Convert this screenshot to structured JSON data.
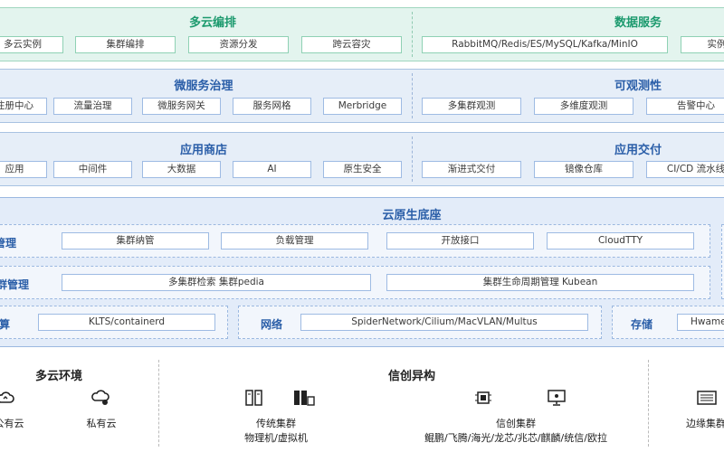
{
  "row1": {
    "left": {
      "title": "多云编排",
      "items": [
        "多云实例",
        "集群编排",
        "资源分发",
        "跨云容灾"
      ]
    },
    "right": {
      "title": "数据服务",
      "items": [
        "RabbitMQ/Redis/ES/MySQL/Kafka/MinIO",
        "实例"
      ]
    }
  },
  "row2": {
    "left": {
      "title": "微服务治理",
      "items": [
        "注册中心",
        "流量治理",
        "微服务网关",
        "服务网格",
        "Merbridge"
      ]
    },
    "right": {
      "title": "可观测性",
      "items": [
        "多集群观测",
        "多维度观测",
        "告警中心"
      ]
    }
  },
  "row3": {
    "left": {
      "title": "应用商店",
      "items": [
        "应用",
        "中间件",
        "大数据",
        "AI",
        "原生安全"
      ]
    },
    "right": {
      "title": "应用交付",
      "items": [
        "渐进式交付",
        "镜像仓库",
        "CI/CD 流水线"
      ]
    }
  },
  "core": {
    "title": "云原生底座",
    "container_mgmt": {
      "label": "容器管理",
      "items": [
        "集群纳管",
        "负载管理",
        "开放接口",
        "CloudTTY"
      ]
    },
    "cluster_mgmt": {
      "label": "多集群管理",
      "items": [
        "多集群检索 集群pedia",
        "集群生命周期管理 Kubean"
      ]
    },
    "compute": {
      "label": "计算",
      "items": [
        "KLTS/containerd"
      ]
    },
    "network": {
      "label": "网络",
      "items": [
        "SpiderNetwork/Cilium/MacVLAN/Multus"
      ]
    },
    "storage": {
      "label": "存储",
      "items": [
        "HwameiStor"
      ]
    }
  },
  "bottom": {
    "multicloud": {
      "title": "多云环境",
      "items": [
        {
          "label": "公有云",
          "icon": "cloud-icon"
        },
        {
          "label": "私有云",
          "icon": "private-cloud-icon"
        }
      ]
    },
    "xinchuang": {
      "title": "信创异构",
      "traditional": {
        "label": "传统集群",
        "sub": "物理机/虚拟机",
        "icons": [
          "server-icon",
          "server-cluster-icon"
        ]
      },
      "xc_cluster": {
        "label": "信创集群",
        "sub": "鲲鹏/飞腾/海光/龙芯/兆芯/麒麟/统信/欧拉",
        "icons": [
          "chip-icon",
          "monitor-icon"
        ]
      }
    },
    "edge": {
      "label": "边缘集群",
      "icon": "edge-device-icon"
    }
  },
  "colors": {
    "green_title": "#1c9a6e",
    "blue_title": "#2a5ea8",
    "green_band": "#e3f4ee",
    "blue_band": "#e6eef8"
  }
}
